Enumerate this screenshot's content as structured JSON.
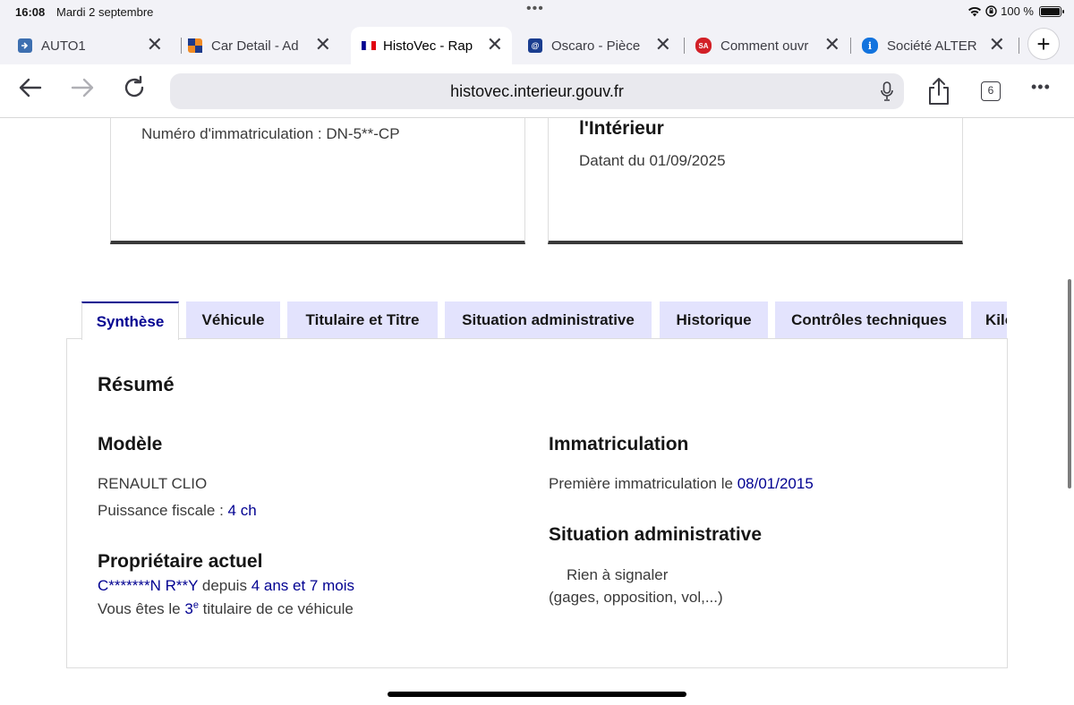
{
  "status": {
    "time": "16:08",
    "date": "Mardi 2 septembre",
    "battery": "100 %"
  },
  "tabs": [
    {
      "title": "AUTO1",
      "favicon_color": "#3d6fb0",
      "favicon_glyph": "",
      "active": false
    },
    {
      "title": "Car Detail - Ad",
      "favicon_color": "#f08a24",
      "favicon_glyph": "",
      "active": false
    },
    {
      "title": "HistoVec - Rap",
      "favicon_color": "#000091",
      "favicon_glyph": "",
      "active": true
    },
    {
      "title": "Oscaro - Pièce",
      "favicon_color": "#1a3d8f",
      "favicon_glyph": "@",
      "active": false
    },
    {
      "title": "Comment ouvr",
      "favicon_color": "#d22027",
      "favicon_glyph": "SA",
      "active": false
    },
    {
      "title": "Société ALTER",
      "favicon_color": "#1273de",
      "favicon_glyph": "i",
      "active": false
    }
  ],
  "toolbar": {
    "url": "histovec.interieur.gouv.fr",
    "tab_count": "6"
  },
  "top_cards": {
    "plate_line": "Numéro d'immatriculation : DN-5**-CP",
    "ministry_heading": "l'Intérieur",
    "dated_line": "Datant du 01/09/2025"
  },
  "page_tabs": [
    {
      "label": "Synthèse",
      "active": true
    },
    {
      "label": "Véhicule",
      "active": false
    },
    {
      "label": "Titulaire et Titre",
      "active": false
    },
    {
      "label": "Situation administrative",
      "active": false
    },
    {
      "label": "Historique",
      "active": false
    },
    {
      "label": "Contrôles techniques",
      "active": false
    },
    {
      "label": "Kilométrage",
      "active": false
    }
  ],
  "summary": {
    "title": "Résumé",
    "model": {
      "heading": "Modèle",
      "name": "RENAULT CLIO",
      "fiscal_label": "Puissance fiscale : ",
      "fiscal_value": "4 ch"
    },
    "owner": {
      "heading": "Propriétaire actuel",
      "name": "C*******N R**Y",
      "since_label": " depuis ",
      "since_value": "4 ans et 7 mois",
      "rank_prefix": "Vous êtes le ",
      "rank_value": "3",
      "rank_sup": "e",
      "rank_suffix": " titulaire de ce véhicule"
    },
    "registration": {
      "heading": "Immatriculation",
      "first_label": "Première immatriculation le ",
      "first_date": "08/01/2015"
    },
    "admin": {
      "heading": "Situation administrative",
      "status": "Rien à signaler",
      "note": "(gages, opposition, vol,...)"
    }
  }
}
